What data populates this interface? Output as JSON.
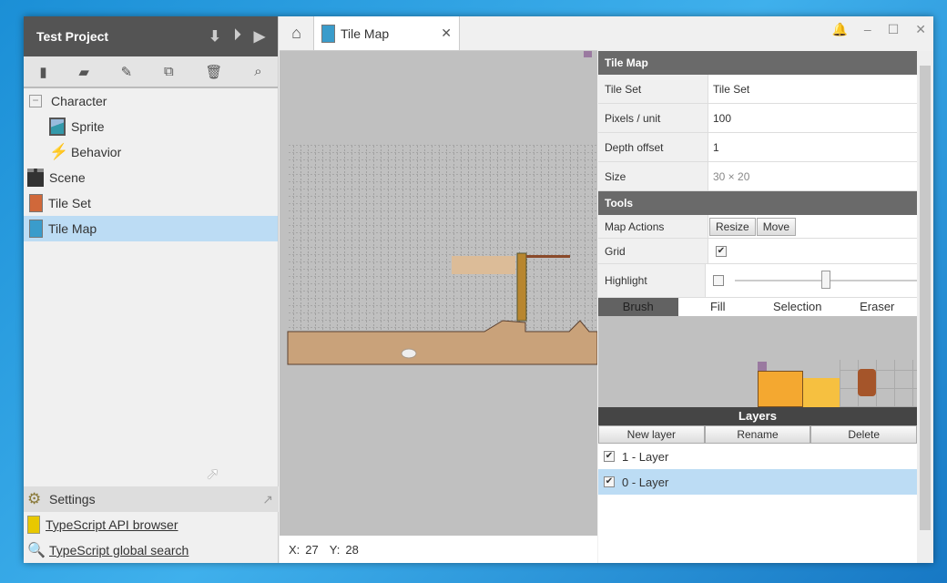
{
  "project": {
    "title": "Test Project"
  },
  "tree": [
    {
      "label": "Character",
      "icon": "collapse-icon",
      "indent": 0
    },
    {
      "label": "Sprite",
      "icon": "sprite-icon",
      "indent": 1
    },
    {
      "label": "Behavior",
      "icon": "lightning-icon",
      "indent": 1
    },
    {
      "label": "Scene",
      "icon": "clapperboard-icon",
      "indent": 0
    },
    {
      "label": "Tile Set",
      "icon": "tileset-file-icon",
      "indent": 0
    },
    {
      "label": "Tile Map",
      "icon": "tilemap-file-icon",
      "indent": 0,
      "selected": true
    }
  ],
  "bottom": {
    "settings": "Settings",
    "api": "TypeScript API browser",
    "search": "TypeScript global search"
  },
  "tab": {
    "label": "Tile Map",
    "close": "✕"
  },
  "status": {
    "x_label": "X:",
    "x": "27",
    "y_label": "Y:",
    "y": "28"
  },
  "props": {
    "header": "Tile Map",
    "tileset_label": "Tile Set",
    "tileset": "Tile Set",
    "ppu_label": "Pixels / unit",
    "ppu": "100",
    "depth_label": "Depth offset",
    "depth": "1",
    "size_label": "Size",
    "size": "30 × 20",
    "tools_header": "Tools",
    "map_actions_label": "Map Actions",
    "resize": "Resize",
    "move": "Move",
    "grid_label": "Grid",
    "grid_checked": true,
    "highlight_label": "Highlight",
    "highlight_value": 0.5
  },
  "brush_tabs": [
    "Brush",
    "Fill",
    "Selection",
    "Eraser"
  ],
  "layers": {
    "header": "Layers",
    "new": "New layer",
    "rename": "Rename",
    "delete": "Delete",
    "items": [
      {
        "label": "1 -  Layer",
        "checked": true
      },
      {
        "label": "0 -  Layer",
        "checked": true,
        "selected": true
      }
    ]
  },
  "check": "✔"
}
